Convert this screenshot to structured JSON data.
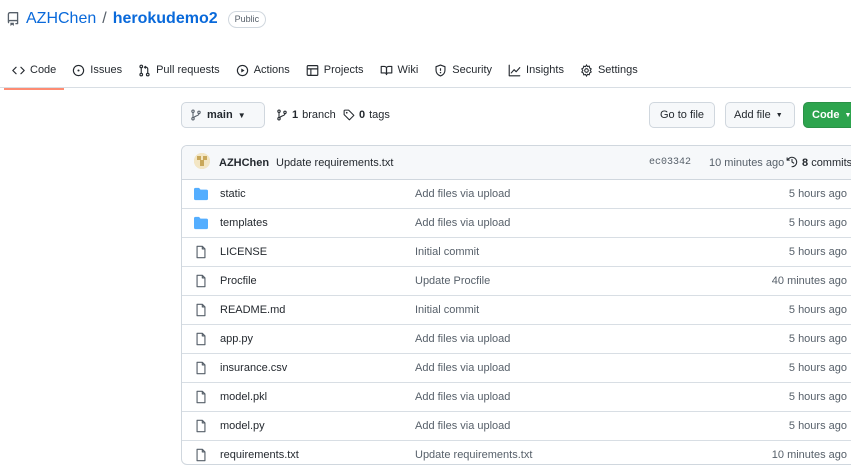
{
  "repo": {
    "owner": "AZHChen",
    "separator": "/",
    "name": "herokudemo2",
    "visibility": "Public"
  },
  "tabs": [
    {
      "label": "Code",
      "icon": "code-icon",
      "active": true
    },
    {
      "label": "Issues",
      "icon": "issue-icon"
    },
    {
      "label": "Pull requests",
      "icon": "pull-request-icon"
    },
    {
      "label": "Actions",
      "icon": "play-icon"
    },
    {
      "label": "Projects",
      "icon": "table-icon"
    },
    {
      "label": "Wiki",
      "icon": "book-icon"
    },
    {
      "label": "Security",
      "icon": "shield-icon"
    },
    {
      "label": "Insights",
      "icon": "graph-icon"
    },
    {
      "label": "Settings",
      "icon": "gear-icon"
    }
  ],
  "branchbar": {
    "branch": "main",
    "branch_count": "1",
    "branch_word": "branch",
    "tag_count": "0",
    "tag_word": "tags",
    "go_to_file": "Go to file",
    "add_file": "Add file",
    "code": "Code"
  },
  "commit": {
    "author": "AZHChen",
    "message": "Update requirements.txt",
    "sha": "ec03342",
    "when": "10 minutes ago",
    "count": "8",
    "count_word": "commits"
  },
  "files": [
    {
      "name": "static",
      "type": "folder",
      "message": "Add files via upload",
      "age": "5 hours ago"
    },
    {
      "name": "templates",
      "type": "folder",
      "message": "Add files via upload",
      "age": "5 hours ago"
    },
    {
      "name": "LICENSE",
      "type": "file",
      "message": "Initial commit",
      "age": "5 hours ago"
    },
    {
      "name": "Procfile",
      "type": "file",
      "message": "Update Procfile",
      "age": "40 minutes ago"
    },
    {
      "name": "README.md",
      "type": "file",
      "message": "Initial commit",
      "age": "5 hours ago"
    },
    {
      "name": "app.py",
      "type": "file",
      "message": "Add files via upload",
      "age": "5 hours ago"
    },
    {
      "name": "insurance.csv",
      "type": "file",
      "message": "Add files via upload",
      "age": "5 hours ago"
    },
    {
      "name": "model.pkl",
      "type": "file",
      "message": "Add files via upload",
      "age": "5 hours ago"
    },
    {
      "name": "model.py",
      "type": "file",
      "message": "Add files via upload",
      "age": "5 hours ago"
    },
    {
      "name": "requirements.txt",
      "type": "file",
      "message": "Update requirements.txt",
      "age": "10 minutes ago"
    }
  ],
  "colors": {
    "link": "#0969da",
    "folder": "#54aeff",
    "tab_underline": "#fd8c73",
    "primary_button": "#2da44e"
  }
}
